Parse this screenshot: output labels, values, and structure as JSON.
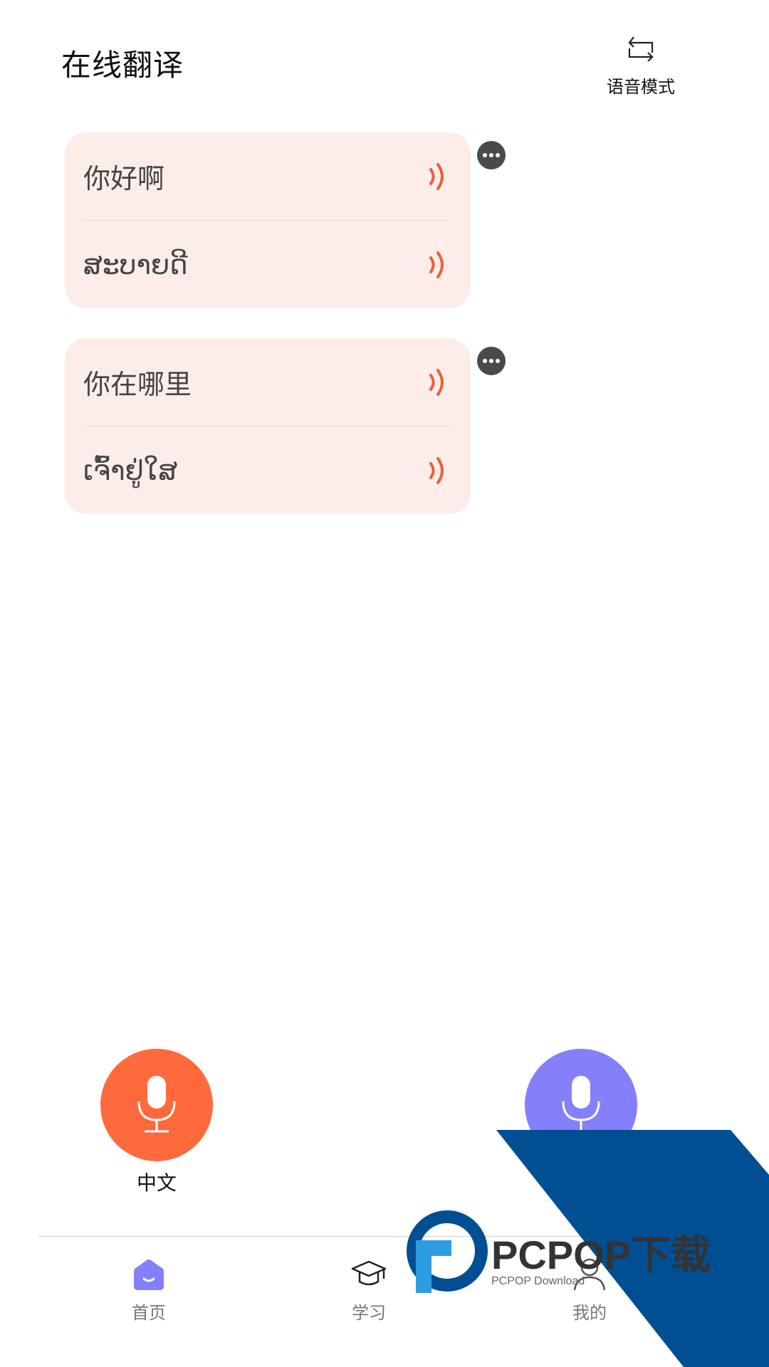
{
  "header": {
    "title": "在线翻译",
    "mode_label": "语音模式",
    "mode_icon": "swap-icon"
  },
  "conversations": [
    {
      "source": "你好啊",
      "target": "ສະບາຍດີ"
    },
    {
      "source": "你在哪里",
      "target": "ເຈົ້າຢູ່ໃສ"
    }
  ],
  "mic_buttons": {
    "left_label": "中文",
    "left_color": "#ff6a3d",
    "right_color": "#8480fb"
  },
  "tabbar": {
    "items": [
      {
        "label": "首页",
        "icon": "home-icon",
        "active": true
      },
      {
        "label": "学习",
        "icon": "graduation-cap-icon",
        "active": false
      },
      {
        "label": "我的",
        "icon": "user-icon",
        "active": false
      }
    ]
  },
  "watermark": {
    "brand": "PCPOP下载",
    "sub": "PCPOP Download"
  },
  "colors": {
    "card_bg": "#fcede9",
    "speaker": "#e9603a",
    "accent_purple": "#8480fb",
    "watermark_blue": "#004f93"
  }
}
